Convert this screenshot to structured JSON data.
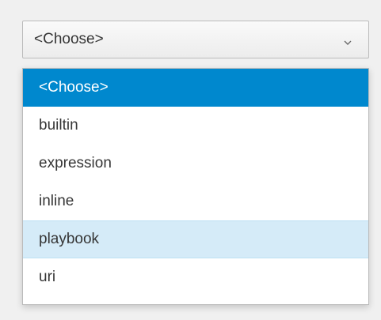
{
  "select": {
    "value": "<Choose>",
    "icon": "chevron-down-icon"
  },
  "dropdown": {
    "options": [
      {
        "label": "<Choose>",
        "state": "selected"
      },
      {
        "label": "builtin",
        "state": "normal"
      },
      {
        "label": "expression",
        "state": "normal"
      },
      {
        "label": "inline",
        "state": "normal"
      },
      {
        "label": "playbook",
        "state": "hovered"
      },
      {
        "label": "uri",
        "state": "normal"
      }
    ]
  },
  "colors": {
    "selected_bg": "#0088ce",
    "selected_text": "#ffffff",
    "hover_bg": "#d5ebf8",
    "text": "#363636",
    "border": "#bbbbbb"
  }
}
